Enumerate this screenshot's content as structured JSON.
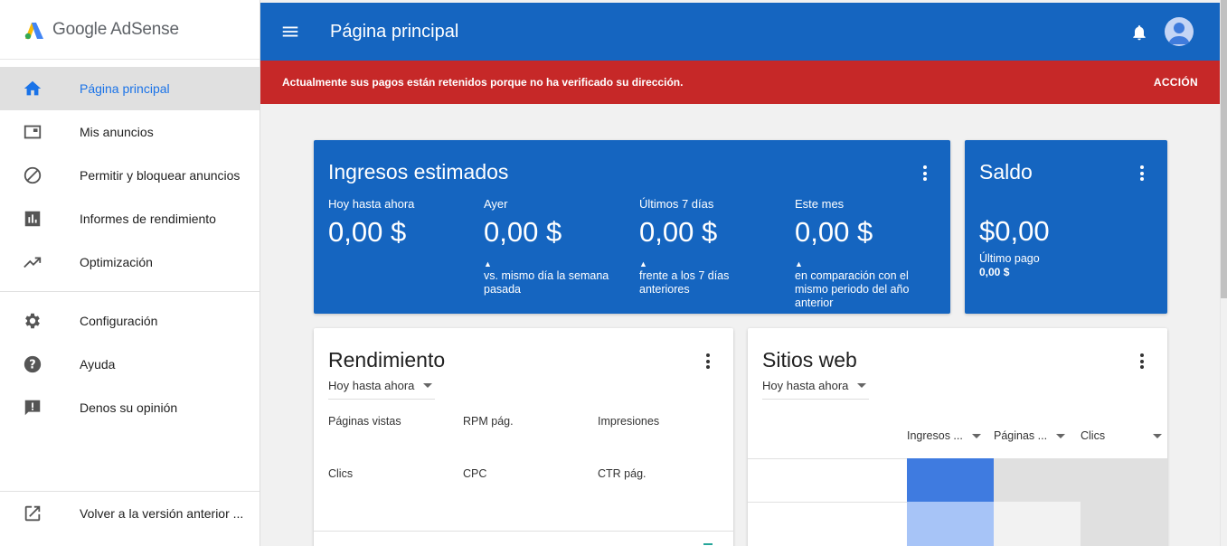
{
  "app": {
    "logo_text": "Google AdSense"
  },
  "sidebar": {
    "items": [
      {
        "label": "Página principal",
        "icon": "home-icon"
      },
      {
        "label": "Mis anuncios",
        "icon": "ad-units-icon"
      },
      {
        "label": "Permitir y bloquear anuncios",
        "icon": "block-icon"
      },
      {
        "label": "Informes de rendimiento",
        "icon": "bar-chart-icon"
      },
      {
        "label": "Optimización",
        "icon": "trending-up-icon"
      },
      {
        "label": "Configuración",
        "icon": "gear-icon"
      },
      {
        "label": "Ayuda",
        "icon": "help-icon"
      },
      {
        "label": "Denos su opinión",
        "icon": "feedback-icon"
      }
    ],
    "back_link": "Volver a la versión anterior ..."
  },
  "header": {
    "title": "Página principal"
  },
  "alert": {
    "message": "Actualmente sus pagos están retenidos porque no ha verificado su dirección.",
    "action": "ACCIÓN"
  },
  "earnings": {
    "title": "Ingresos estimados",
    "metrics": [
      {
        "label": "Hoy hasta ahora",
        "value": "0,00 $",
        "triangle": "",
        "comparison": ""
      },
      {
        "label": "Ayer",
        "value": "0,00 $",
        "triangle": "▲",
        "comparison": "vs. mismo día la semana pasada"
      },
      {
        "label": "Últimos 7 días",
        "value": "0,00 $",
        "triangle": "▲",
        "comparison": "frente a los 7 días anteriores"
      },
      {
        "label": "Este mes",
        "value": "0,00 $",
        "triangle": "▲",
        "comparison": "en comparación con el mismo periodo del año anterior"
      }
    ]
  },
  "balance": {
    "title": "Saldo",
    "value": "$0,00",
    "last_payment_label": "Último pago",
    "last_payment_value": "0,00 $"
  },
  "performance": {
    "title": "Rendimiento",
    "range": "Hoy hasta ahora",
    "stats": [
      "Páginas vistas",
      "RPM pág.",
      "Impresiones",
      "Clics",
      "CPC",
      "CTR pág."
    ]
  },
  "sites": {
    "title": "Sitios web",
    "range": "Hoy hasta ahora",
    "columns": [
      "Ingresos ...",
      "Páginas ...",
      "Clics"
    ]
  },
  "colors": {
    "primary": "#1565c0",
    "alert": "#c62828",
    "active_text": "#1a73e8"
  }
}
